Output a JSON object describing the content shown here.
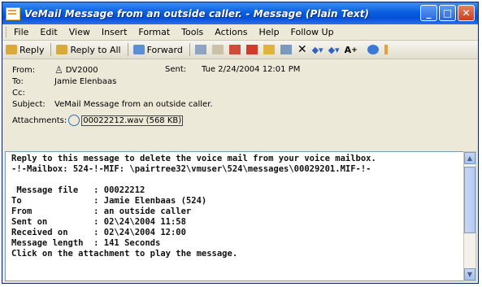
{
  "window": {
    "title": "VeMail Message from an outside caller. - Message (Plain Text)"
  },
  "menu": [
    "File",
    "Edit",
    "View",
    "Insert",
    "Format",
    "Tools",
    "Actions",
    "Help",
    "Follow Up"
  ],
  "toolbar": {
    "reply": "Reply",
    "reply_all": "Reply to All",
    "forward": "Forward",
    "font_size": "A"
  },
  "header": {
    "from_label": "From:",
    "from_value": "DV2000",
    "sent_label": "Sent:",
    "sent_value": "Tue 2/24/2004 12:01 PM",
    "to_label": "To:",
    "to_value": "Jamie Elenbaas",
    "cc_label": "Cc:",
    "subject_label": "Subject:",
    "subject_value": "VeMail Message from an outside caller.",
    "attachments_label": "Attachments:",
    "attachment_value": "00022212.wav (568 KB)"
  },
  "body_lines": [
    "Reply to this message to delete the voice mail from your voice mailbox.",
    "-!-Mailbox: 524-!-MIF: \\pairtree32\\vmuser\\524\\messages\\00029201.MIF-!-",
    "",
    " Message file   : 00022212",
    "To              : Jamie Elenbaas (524)",
    "From            : an outside caller",
    "Sent on         : 02\\24\\2004 11:58",
    "Received on     : 02\\24\\2004 12:00",
    "Message length  : 141 Seconds",
    "Click on the attachment to play the message."
  ],
  "icons": {
    "window": "message-icon",
    "sender": "person-icon",
    "attachment": "wav-file-icon"
  }
}
